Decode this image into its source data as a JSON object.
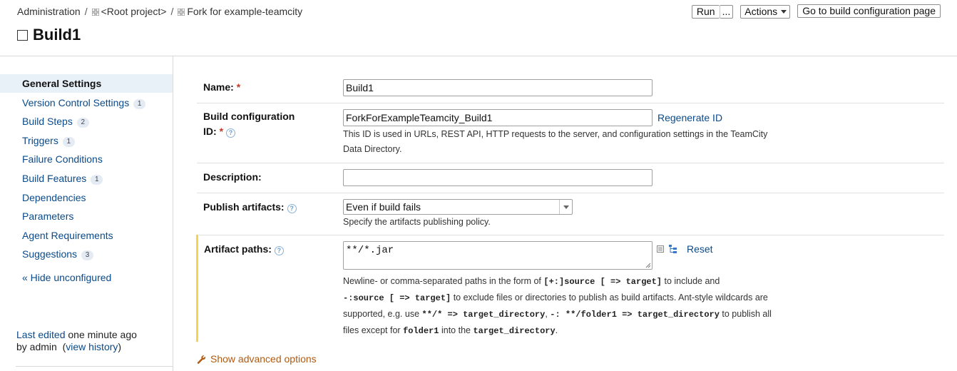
{
  "breadcrumb": {
    "admin": "Administration",
    "root": "<Root project>",
    "project": "Fork for example-teamcity"
  },
  "title": "Build1",
  "top_actions": {
    "run": "Run",
    "run_more": "...",
    "actions": "Actions",
    "goto": "Go to build configuration page"
  },
  "sidebar": {
    "items": [
      {
        "label": "General Settings",
        "count": null,
        "active": true
      },
      {
        "label": "Version Control Settings",
        "count": "1"
      },
      {
        "label": "Build Steps",
        "count": "2"
      },
      {
        "label": "Triggers",
        "count": "1"
      },
      {
        "label": "Failure Conditions",
        "count": null
      },
      {
        "label": "Build Features",
        "count": "1"
      },
      {
        "label": "Dependencies",
        "count": null
      },
      {
        "label": "Parameters",
        "count": null
      },
      {
        "label": "Agent Requirements",
        "count": null
      },
      {
        "label": "Suggestions",
        "count": "3"
      }
    ],
    "hide_unconfigured": "« Hide unconfigured",
    "last_edited_link": "Last edited",
    "last_edited_time": "one minute ago",
    "last_edited_by": "by admin",
    "view_history": "view history"
  },
  "form": {
    "name_label": "Name:",
    "name_value": "Build1",
    "id_label_1": "Build configuration",
    "id_label_2": "ID:",
    "id_value": "ForkForExampleTeamcity_Build1",
    "regenerate": "Regenerate ID",
    "id_hint_1": "This ID is used in URLs, REST API, HTTP requests to the server, and configuration settings in the TeamCity",
    "id_hint_2": "Data Directory.",
    "description_label": "Description:",
    "description_value": "",
    "publish_label": "Publish artifacts:",
    "publish_value": "Even if build fails",
    "publish_hint": "Specify the artifacts publishing policy.",
    "artifact_label": "Artifact paths:",
    "artifact_value": "**/*.jar",
    "reset": "Reset",
    "artifact_hint": {
      "l1_a": "Newline- or comma-separated paths in the form of ",
      "l1_code": "[+:]source [ => target]",
      "l1_b": " to include and",
      "l2_code": "-:source [ => target]",
      "l2_b": " to exclude files or directories to publish as build artifacts. Ant-style wildcards are",
      "l3_a": "supported, e.g. use ",
      "l3_code1": "**/* => target_directory",
      "l3_b": ", ",
      "l3_code2": "-: **/folder1 => target_directory",
      "l3_c": " to publish all",
      "l4_a": "files except for ",
      "l4_code1": "folder1",
      "l4_b": " into the ",
      "l4_code2": "target_directory",
      "l4_c": "."
    },
    "advanced": "Show advanced options"
  },
  "colors": {
    "link": "#0a4a8a",
    "active_bg": "#e8f0f8",
    "highlight": "#f0d64a",
    "advanced": "#b05a10",
    "required": "#c0392b"
  }
}
